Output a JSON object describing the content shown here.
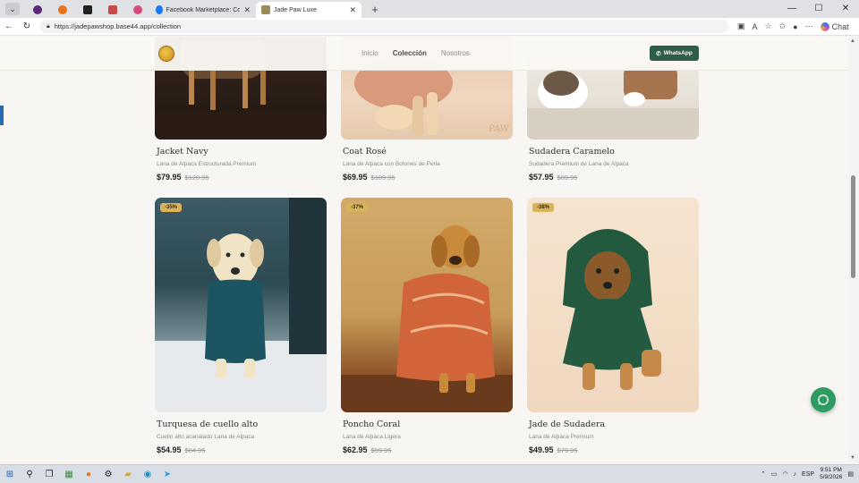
{
  "browser": {
    "tabs": [
      {
        "title": "Facebook Marketplace: Compra y..."
      },
      {
        "title": "Jade Paw Luxe",
        "active": true
      }
    ],
    "url": "https://jadepawshop.base44.app/collection",
    "chat_label": "Chat"
  },
  "site": {
    "nav": [
      "Inicio",
      "Colección",
      "Nosotros"
    ],
    "active_nav": "Colección",
    "whatsapp_label": "WhatsApp"
  },
  "products": [
    {
      "name": "Jacket Navy",
      "desc": "Lana de Alpaca Estructurada Premium",
      "price": "$79.95",
      "old_price": "$120.95"
    },
    {
      "name": "Coat Rosé",
      "desc": "Lana de Alpaca con Botones de Perla",
      "price": "$69.95",
      "old_price": "$109.95"
    },
    {
      "name": "Sudadera Caramelo",
      "desc": "Sudadera Premium de Lana de Alpaca",
      "price": "$57.95",
      "old_price": "$89.95"
    },
    {
      "name": "Turquesa de cuello alto",
      "desc": "Cuello alto acanalado Lana de Alpaca",
      "price": "$54.95",
      "old_price": "$84.95",
      "badge": "-35%"
    },
    {
      "name": "Poncho Coral",
      "desc": "Lana de Alpaca Ligera",
      "price": "$62.95",
      "old_price": "$99.95",
      "badge": "-37%"
    },
    {
      "name": "Jade de Sudadera",
      "desc": "Lana de Alpaca Premium",
      "price": "$49.95",
      "old_price": "$79.95",
      "badge": "-38%"
    }
  ],
  "image_watermark": "PAW",
  "taskbar": {
    "lang": "ESP",
    "time": "9:51 PM",
    "date": "5/9/2026"
  },
  "colors": {
    "brand_green": "#2f5e46",
    "badge_gold": "#d9b35c",
    "fab_green": "#2f9a61"
  }
}
